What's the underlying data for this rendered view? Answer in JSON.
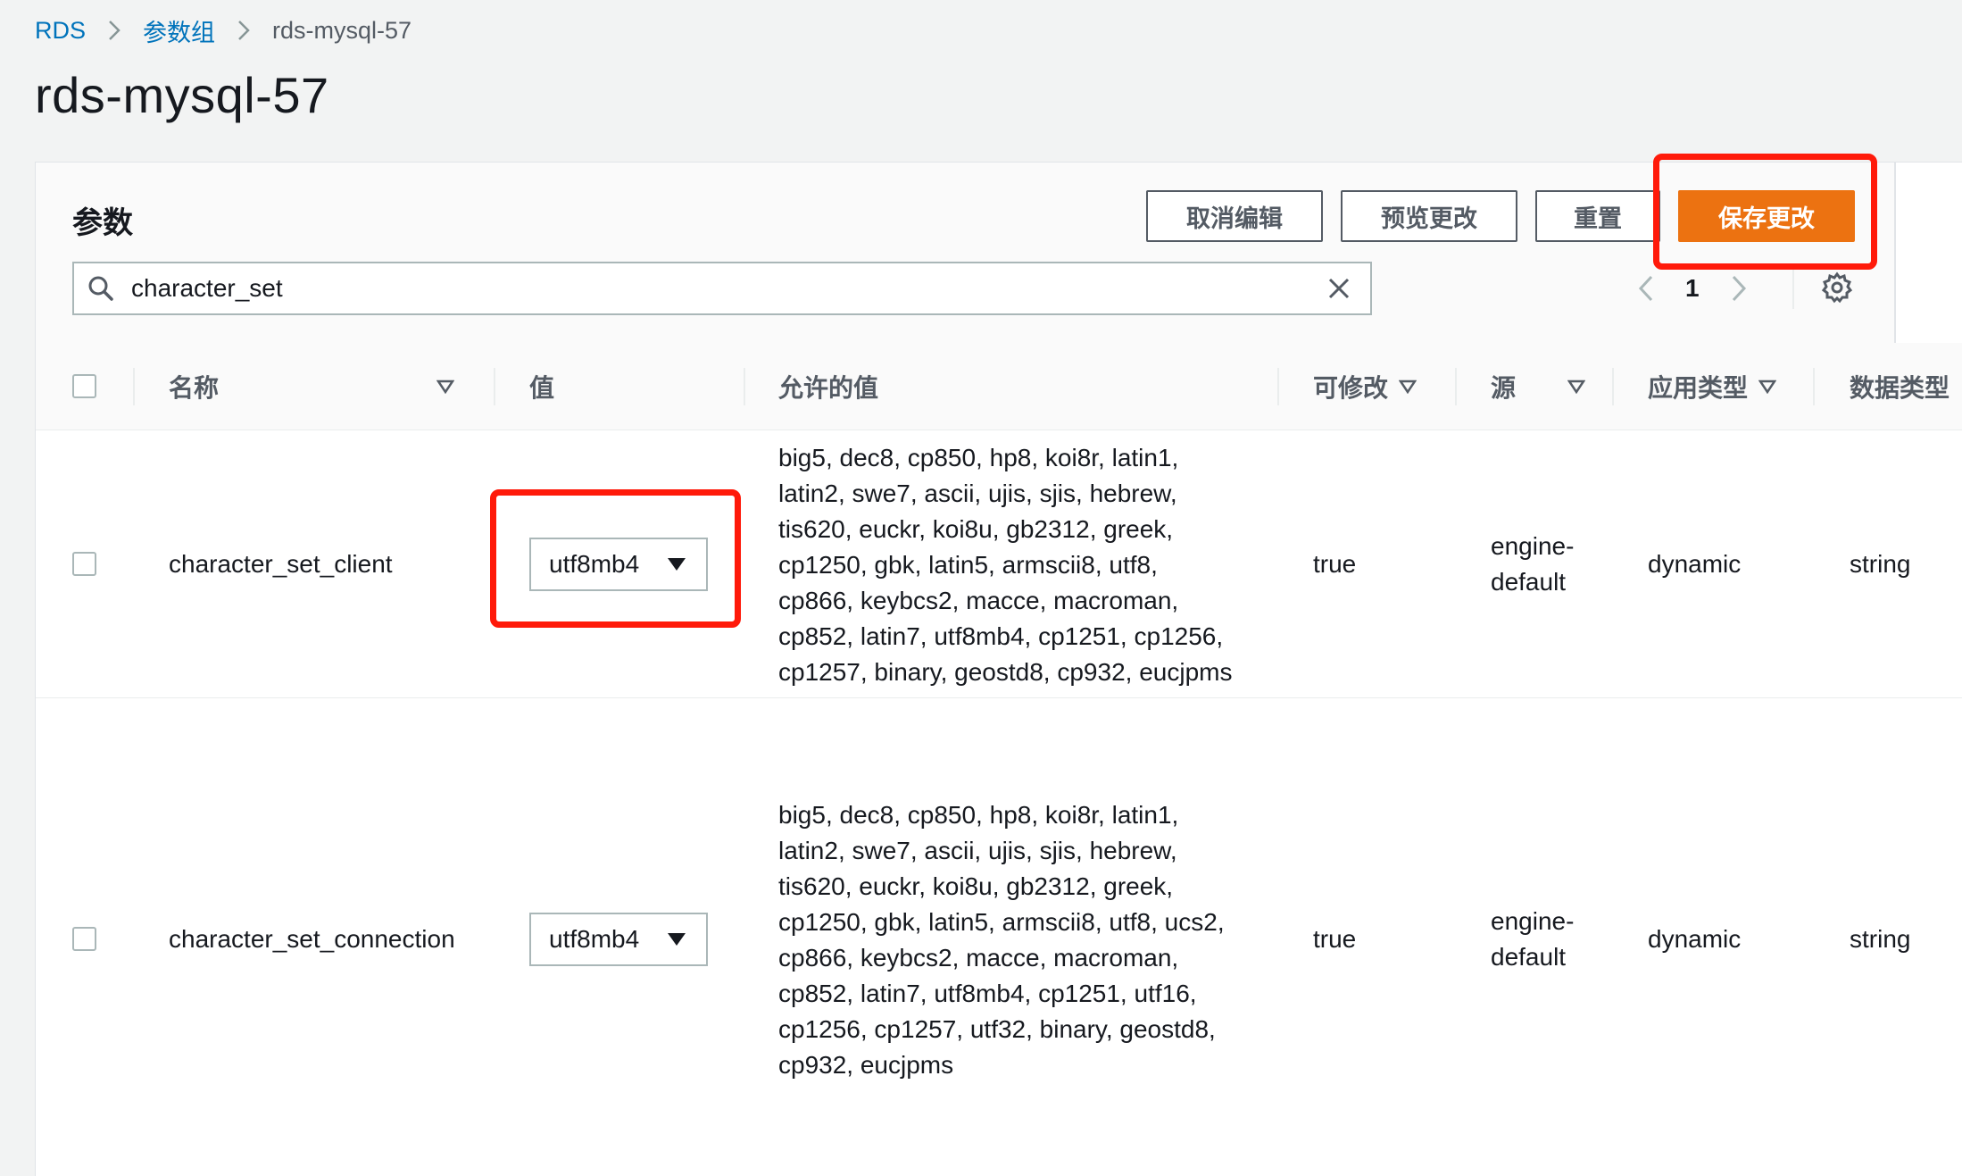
{
  "breadcrumb": {
    "root": "RDS",
    "parent": "参数组",
    "current": "rds-mysql-57"
  },
  "page_title": "rds-mysql-57",
  "panel": {
    "title": "参数",
    "buttons": {
      "cancel": "取消编辑",
      "preview": "预览更改",
      "reset": "重置",
      "save": "保存更改"
    },
    "search": {
      "value": "character_set"
    },
    "pagination": {
      "current_page": "1"
    }
  },
  "columns": {
    "name": "名称",
    "value": "值",
    "allowed": "允许的值",
    "modifiable": "可修改",
    "source": "源",
    "apply_type": "应用类型",
    "data_type": "数据类型"
  },
  "rows": [
    {
      "name": "character_set_client",
      "value": "utf8mb4",
      "allowed_lines": [
        "big5, dec8, cp850, hp8, koi8r, latin1,",
        "latin2, swe7, ascii, ujis, sjis, hebrew,",
        "tis620, euckr, koi8u, gb2312, greek,",
        "cp1250, gbk, latin5, armscii8, utf8,",
        "cp866, keybcs2, macce, macroman,",
        "cp852, latin7, utf8mb4, cp1251, cp1256,",
        "cp1257, binary, geostd8, cp932, eucjpms"
      ],
      "modifiable": "true",
      "source_line1": "engine-",
      "source_line2": "default",
      "apply_type": "dynamic",
      "data_type": "string"
    },
    {
      "name": "character_set_connection",
      "value": "utf8mb4",
      "allowed_lines": [
        "big5, dec8, cp850, hp8, koi8r, latin1,",
        "latin2, swe7, ascii, ujis, sjis, hebrew,",
        "tis620, euckr, koi8u, gb2312, greek,",
        "cp1250, gbk, latin5, armscii8, utf8, ucs2,",
        "cp866, keybcs2, macce, macroman,",
        "cp852, latin7, utf8mb4, cp1251, utf16,",
        "cp1256, cp1257, utf32, binary, geostd8,",
        "cp932, eucjpms"
      ],
      "modifiable": "true",
      "source_line1": "engine-",
      "source_line2": "default",
      "apply_type": "dynamic",
      "data_type": "string"
    }
  ],
  "colors": {
    "link": "#0073bb",
    "primary": "#ec7211",
    "highlight": "#ff1a0a"
  },
  "icons": {
    "breadcrumb_sep": "chevron-right-icon",
    "search": "search-icon",
    "clear": "close-icon",
    "sort": "caret-down-icon",
    "settings": "gear-icon"
  }
}
